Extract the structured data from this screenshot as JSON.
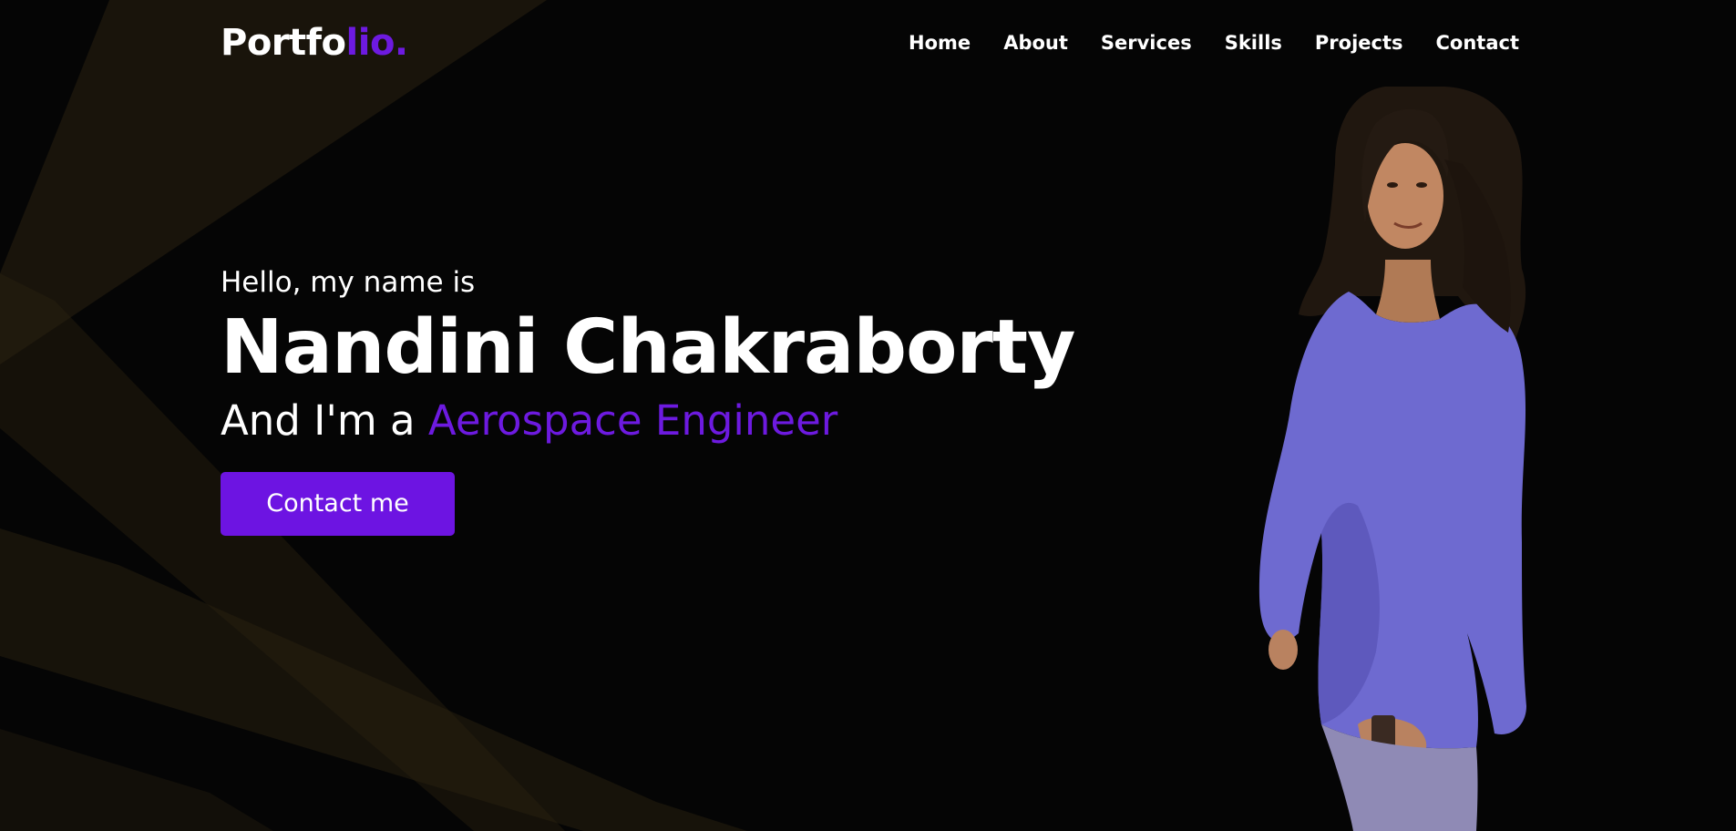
{
  "brand": {
    "logo_main": "Portfo",
    "logo_accent": "lio."
  },
  "nav": {
    "items": [
      {
        "label": "Home"
      },
      {
        "label": "About"
      },
      {
        "label": "Services"
      },
      {
        "label": "Skills"
      },
      {
        "label": "Projects"
      },
      {
        "label": "Contact"
      }
    ]
  },
  "hero": {
    "greeting": "Hello, my name is",
    "name": "Nandini Chakraborty",
    "role_prefix": "And I'm a ",
    "role_accent": "Aerospace Engineer",
    "cta_label": "Contact me"
  },
  "colors": {
    "background": "#050505",
    "accent": "#6d1ae0",
    "button": "#6d14e2",
    "text": "#ffffff",
    "stripe": "#2a2110"
  }
}
